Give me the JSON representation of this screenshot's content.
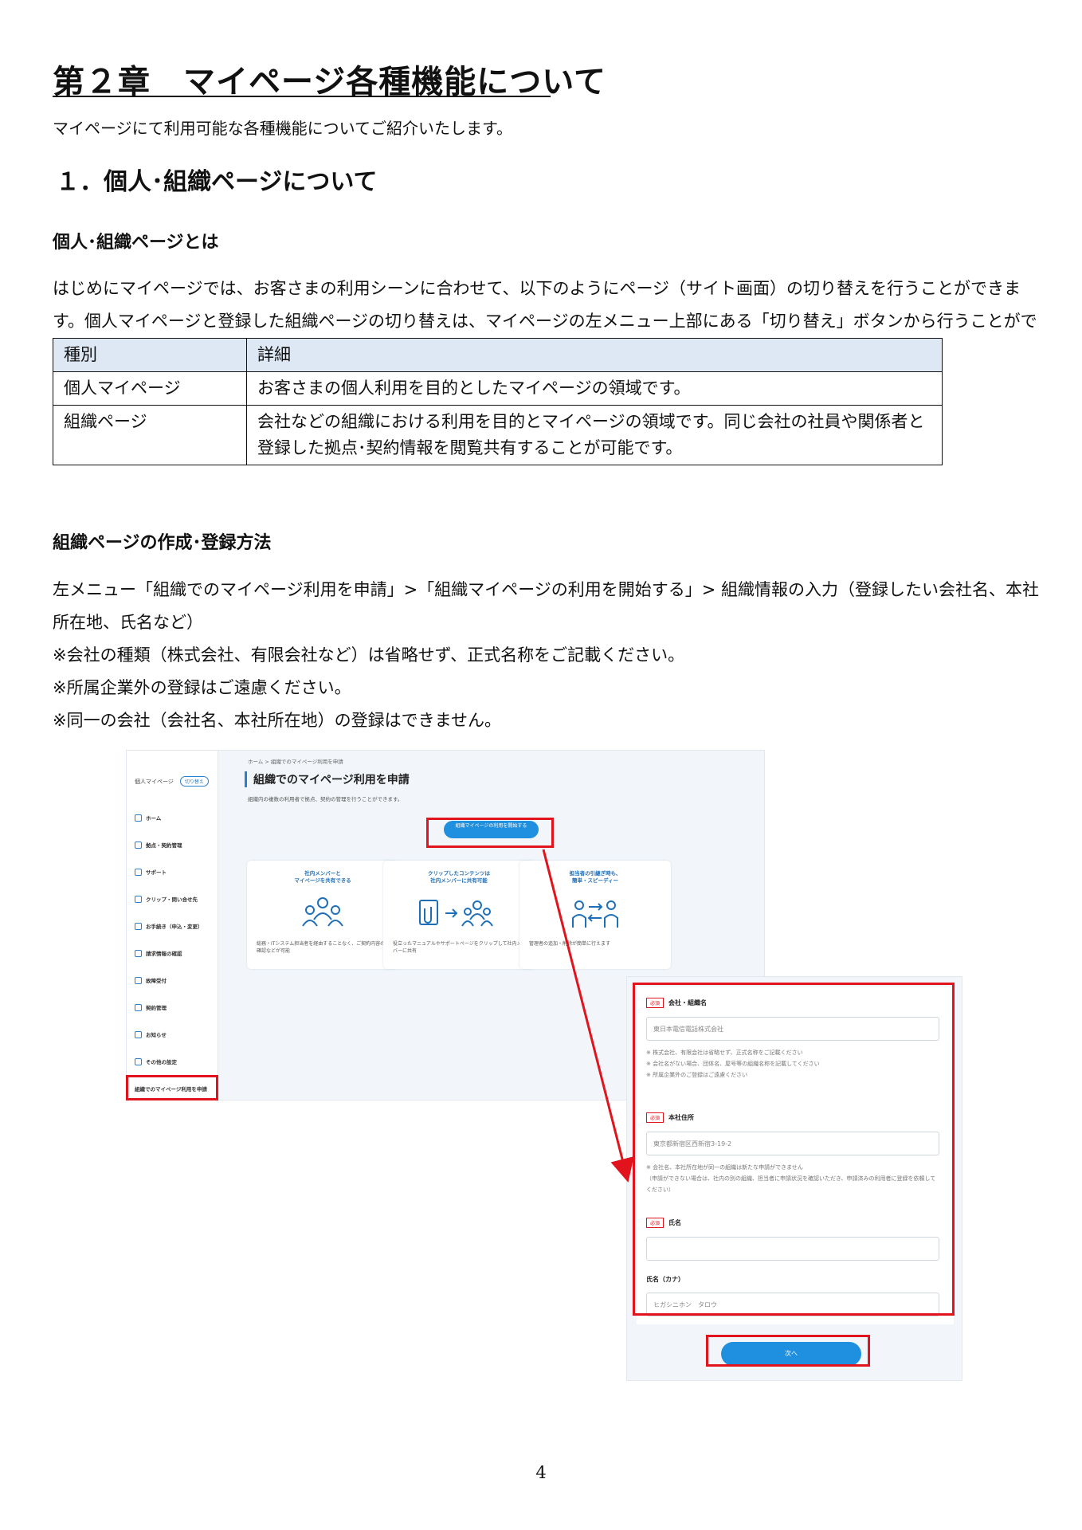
{
  "chapter_title": "第２章　マイページ各種機能について",
  "intro": "マイページにて利用可能な各種機能についてご紹介いたします。",
  "section_title": "１．個人･組織ページについて",
  "subhead1": "個人･組織ページとは",
  "para1": "はじめにマイページでは、お客さまの利用シーンに合わせて、以下のようにページ（サイト画面）の切り替えを行うことができます。個人マイページと登録した組織ページの切り替えは、マイページの左メニュー上部にある「切り替え」ボタンから行うことができます。",
  "table": {
    "headers": [
      "種別",
      "詳細"
    ],
    "rows": [
      {
        "type": "個人マイページ",
        "detail": "お客さまの個人利用を目的としたマイページの領域です。"
      },
      {
        "type": "組織ページ",
        "detail": "会社などの組織における利用を目的とマイページの領域です。同じ会社の社員や関係者と登録した拠点･契約情報を閲覧共有することが可能です。"
      }
    ]
  },
  "subhead2": "組織ページの作成･登録方法",
  "para2": "左メニュー「組織でのマイページ利用を申請」>「組織マイページの利用を開始する」> 組織情報の入力（登録したい会社名、本社所在地、氏名など）",
  "notes": [
    "※会社の種類（株式会社、有限会社など）は省略せず、正式名称をご記載ください。",
    "※所属企業外の登録はご遠慮ください。",
    "※同一の会社（会社名、本社所在地）の登録はできません。"
  ],
  "screenshot1": {
    "sidebar_head": "個人マイページ",
    "toggle_label": "切り替え",
    "menu": [
      "ホーム",
      "拠点・契約管理",
      "サポート",
      "クリップ・問い合せ先",
      "お手続き（申込・変更）",
      "請求情報の確認",
      "故障受付",
      "契約管理",
      "お知らせ",
      "その他の設定"
    ],
    "menu_last": "組織でのマイページ利用を申請",
    "breadcrumb": "ホーム > 組織でのマイページ利用を申請",
    "title": "組織でのマイページ利用を申請",
    "desc": "組織内の複数の利用者で拠点、契約の管理を行うことができます。",
    "start_button": "組織マイページの利用を開始する",
    "cards": [
      {
        "title": "社内メンバーと\nマイページを共有できる",
        "desc": "総務・ITシステム担当者を経由することなく、ご契約内容のご確認などが可能"
      },
      {
        "title": "クリップしたコンテンツは\n社内メンバーに共有可能",
        "desc": "役立ったマニュアルやサポートページをクリップして社内メンバーに共有"
      },
      {
        "title": "担当者の引継ぎ時も、\n簡単・スピーディー",
        "desc": "管理者の追加・削除が簡単に行えます"
      }
    ]
  },
  "screenshot2": {
    "required_label": "必須",
    "company_label": "会社・組織名",
    "company_value": "東日本電信電話株式会社",
    "company_notes": "※ 株式会社、有限会社は省略せず、正式名称をご記載ください\n※ 会社名がない場合、団体名、屋号等の組織名称を記載してください\n※ 所属企業外のご登録はご遠慮ください",
    "address_label": "本社住所",
    "address_value": "東京都新宿区西新宿3-19-2",
    "address_notes": "※ 会社名、本社所在地が同一の組織は新たな申請ができません\n（申請ができない場合は、社内の別の組織、担当者に申請状況を確認いただき、申請済みの利用者に登録を依頼してください）",
    "name_label": "氏名",
    "kana_label": "氏名（カナ）",
    "kana_value": "ヒガシニホン　タロウ",
    "next_button": "次へ"
  },
  "page_number": "4",
  "colors": {
    "accent_blue": "#1f8fe0",
    "highlight_red": "#e1141e",
    "table_header_bg": "#dde8f4"
  }
}
